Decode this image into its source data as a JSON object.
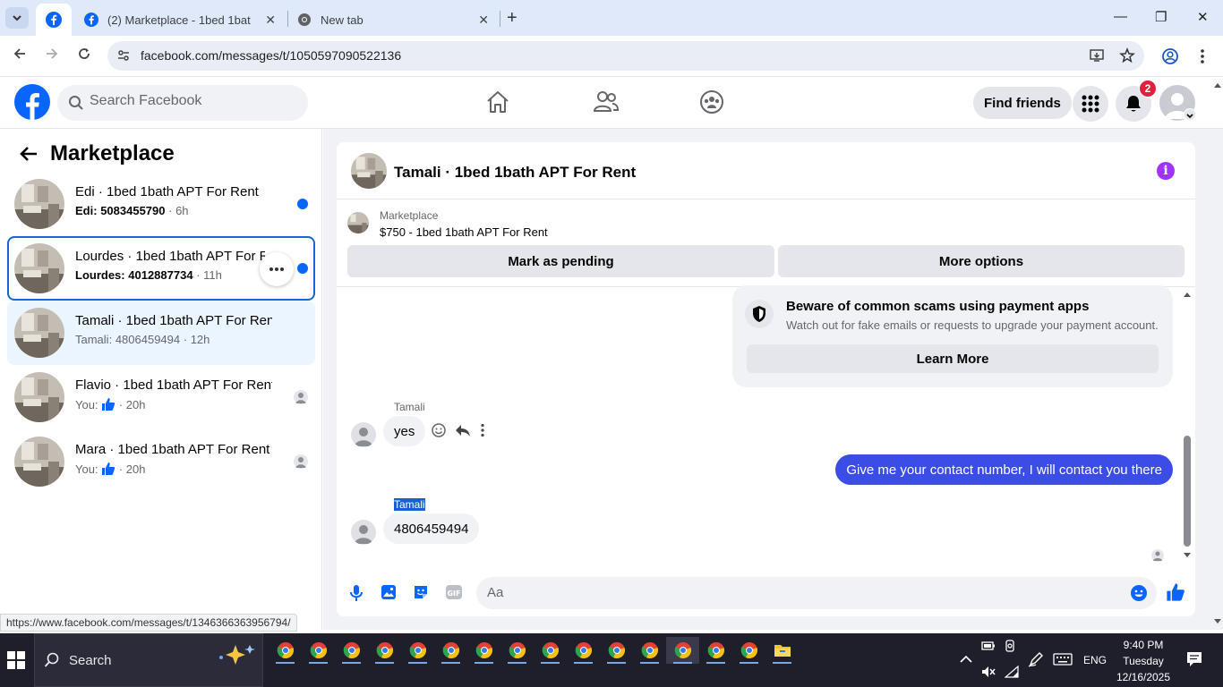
{
  "browser": {
    "tabs": [
      {
        "title": "(2) Marketplace - 1bed 1bath APT For Rent"
      },
      {
        "title": "New tab"
      }
    ],
    "url": "facebook.com/messages/t/1050597090522136",
    "status_url": "https://www.facebook.com/messages/t/1346366363956794/"
  },
  "fb": {
    "search_placeholder": "Search Facebook",
    "find_friends": "Find friends",
    "notification_count": "2"
  },
  "sidebar": {
    "title": "Marketplace",
    "conversations": [
      {
        "title": "Edi · 1bed 1bath APT For Rent",
        "sender": "Edi:",
        "preview": "5083455790",
        "time": "6h"
      },
      {
        "title": "Lourdes · 1bed 1bath APT For Rent",
        "sender": "Lourdes:",
        "preview": "4012887734",
        "time": "11h"
      },
      {
        "title": "Tamali · 1bed 1bath APT For Rent",
        "sender": "Tamali:",
        "preview": "4806459494",
        "time": "12h"
      },
      {
        "title": "Flavio · 1bed 1bath APT For Rent",
        "sender": "You:",
        "preview": "",
        "time": "20h"
      },
      {
        "title": "Mara · 1bed 1bath APT For Rent",
        "sender": "You:",
        "preview": "",
        "time": "20h"
      }
    ]
  },
  "chat": {
    "title": "Tamali · 1bed 1bath APT For Rent",
    "marketplace_label": "Marketplace",
    "listing": "$750 - 1bed 1bath APT For Rent",
    "mark_pending": "Mark as pending",
    "more_options": "More options",
    "scam_title": "Beware of common scams using payment apps",
    "scam_body": "Watch out for fake emails or requests to upgrade your payment account.",
    "learn_more": "Learn More",
    "messages": [
      {
        "sender": "Tamali",
        "text": "yes"
      },
      {
        "sender": "You",
        "text": "Give me your contact number, I will contact you there"
      },
      {
        "sender": "Tamali",
        "text": "4806459494"
      }
    ],
    "composer_placeholder": "Aa"
  },
  "taskbar": {
    "search": "Search",
    "language": "ENG",
    "time": "9:40 PM",
    "day": "Tuesday",
    "date": "12/16/2025"
  },
  "colors": {
    "fb_blue": "#0866ff",
    "outgoing_bubble": "#3b4de6",
    "selected_row": "#ebf5ff"
  }
}
